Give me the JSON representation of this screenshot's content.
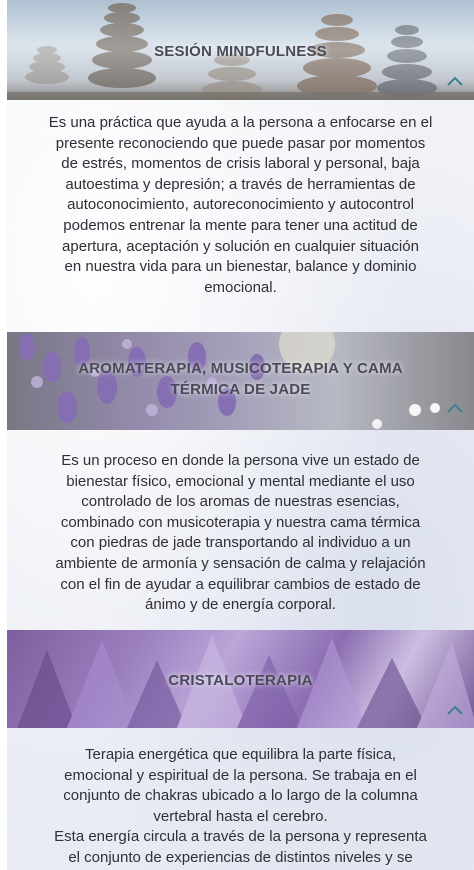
{
  "sections": [
    {
      "title": "SESIÓN MINDFULNESS",
      "body": "Es una práctica que ayuda a la persona a enfocarse en el\npresente reconociendo que puede pasar por momentos\nde estrés, momentos de crisis laboral y personal, baja\nautoestima y depresión; a través de herramientas de\nautoconocimiento, autoreconocimiento y autocontrol\npodemos entrenar la mente para tener una actitud de\napertura, aceptación y solución en cualquier situación\nen nuestra vida para un bienestar, balance y dominio\nemocional.",
      "expanded": true,
      "chevron_icon": "chevron-up-icon"
    },
    {
      "title": "AROMATERAPIA, MUSICOTERAPIA Y CAMA TÉRMICA DE JADE",
      "body": "Es un proceso en donde la persona vive un estado de\nbienestar físico, emocional y mental mediante el uso\ncontrolado de los aromas de nuestras esencias,\ncombinado con musicoterapia y nuestra cama térmica\ncon piedras de jade transportando al individuo a un\nambiente de armonía y sensación de calma y relajación\ncon el fin de ayudar a equilibrar cambios de estado de\nánimo y de energía corporal.",
      "expanded": true,
      "chevron_icon": "chevron-up-icon"
    },
    {
      "title": "CRISTALOTERAPIA",
      "body": "Terapia energética que equilibra la parte física,\nemocional y espiritual de la persona. Se trabaja en el\nconjunto de chakras ubicado a lo largo de la columna\nvertebral hasta el cerebro.\nEsta energía circula a través de la persona y representa\nel conjunto de experiencias de distintos niveles y se",
      "expanded": true,
      "chevron_icon": "chevron-up-icon"
    }
  ],
  "colors": {
    "title_text": "#4a4a58",
    "body_text": "#2f2f35",
    "chevron": "#3f7f8f"
  }
}
